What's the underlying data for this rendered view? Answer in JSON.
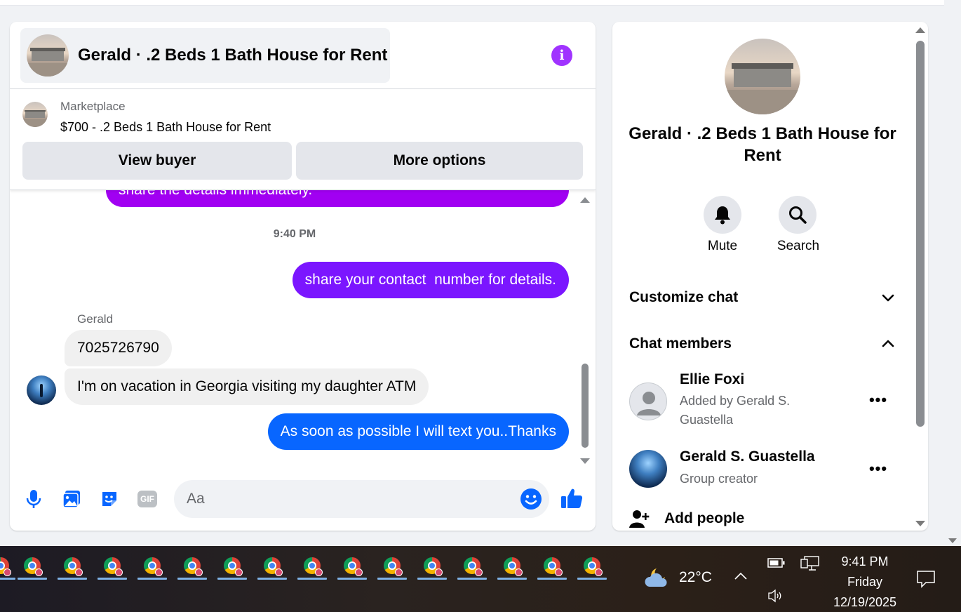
{
  "chat": {
    "header_title": "Gerald · .2 Beds 1 Bath House for Rent",
    "marketplace": {
      "label": "Marketplace",
      "item": "$700 - .2 Beds 1 Bath House for Rent",
      "view_buyer": "View buyer",
      "more_options": "More options"
    },
    "messages": {
      "cut_text": "share the details immediately.",
      "timestamp": "9:40 PM",
      "out1": "share your contact  number for details.",
      "sender": "Gerald",
      "in1": "7025726790",
      "in2": "I'm on vacation in Georgia visiting my daughter ATM",
      "out2": "As soon as possible I will text you..Thanks"
    },
    "composer": {
      "placeholder": "Aa"
    }
  },
  "info": {
    "title": "Gerald · .2 Beds 1 Bath House for Rent",
    "mute_label": "Mute",
    "search_label": "Search",
    "customize_label": "Customize chat",
    "members_label": "Chat members",
    "members": [
      {
        "name": "Ellie Foxi",
        "subtitle": "Added by Gerald S. Guastella"
      },
      {
        "name": "Gerald S. Guastella",
        "subtitle": "Group creator"
      }
    ],
    "add_people": "Add people"
  },
  "taskbar": {
    "temperature": "22°C",
    "time": "9:41 PM",
    "day": "Friday",
    "date": "12/19/2025"
  },
  "colors": {
    "outgoing_purple": "#7b16ff",
    "outgoing_blue": "#0866ff",
    "info_accent": "#a033ff",
    "incoming_gray": "#f0f0f0"
  }
}
